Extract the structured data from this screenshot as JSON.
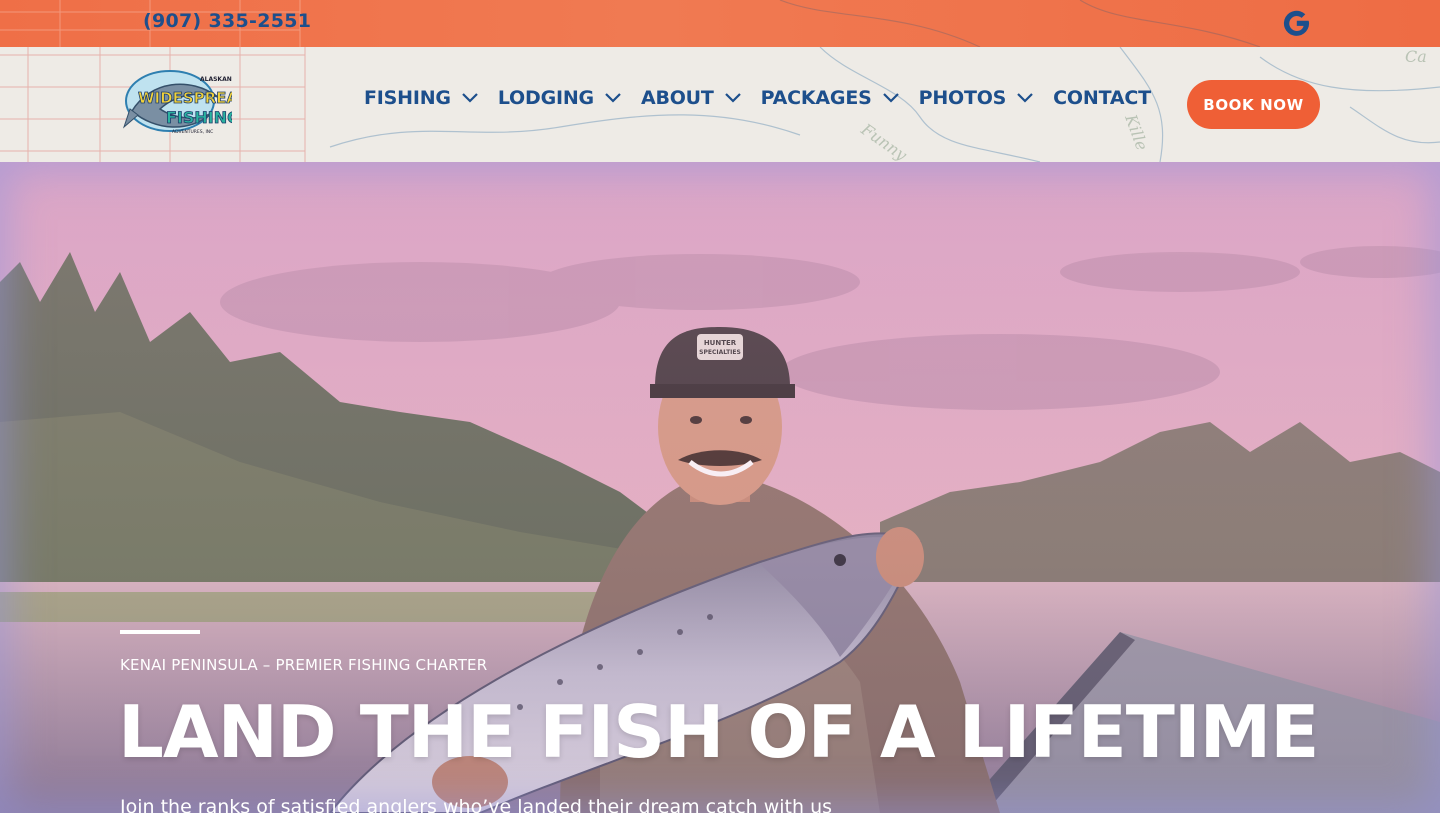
{
  "topbar": {
    "phone": "(907) 335-2551",
    "social_icon": "google-icon",
    "background_color": "#ef6f47"
  },
  "header": {
    "logo": {
      "line1": "ALASKAN",
      "line2": "WIDESPREAD",
      "line3": "FISHING",
      "line4": "ADVENTURES, INC"
    },
    "nav": [
      {
        "label": "FISHING",
        "has_dropdown": true,
        "icon": "chevron-down-icon"
      },
      {
        "label": "LODGING",
        "has_dropdown": true,
        "icon": "chevron-down-icon"
      },
      {
        "label": "ABOUT",
        "has_dropdown": true,
        "icon": "chevron-down-icon"
      },
      {
        "label": "PACKAGES",
        "has_dropdown": true,
        "icon": "chevron-down-icon"
      },
      {
        "label": "PHOTOS",
        "has_dropdown": true,
        "icon": "chevron-down-icon"
      },
      {
        "label": "CONTACT",
        "has_dropdown": false
      }
    ],
    "cta_label": "BOOK NOW"
  },
  "hero": {
    "eyebrow": "KENAI PENINSULA – PREMIER FISHING CHARTER",
    "headline": "LAND THE FISH OF A LIFETIME",
    "subtext": "Join the ranks of satisfied anglers who’ve landed their dream catch with us",
    "cap_text": "HUNTER SPECIALTIES"
  },
  "colors": {
    "brand_blue": "#1d4f8c",
    "accent_orange": "#ef5f36",
    "text_white": "#ffffff"
  }
}
